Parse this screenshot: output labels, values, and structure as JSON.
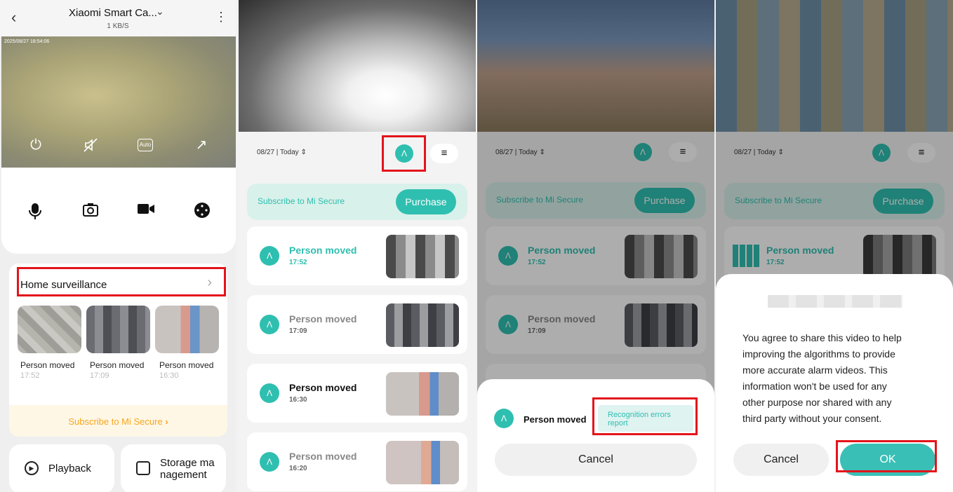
{
  "colors": {
    "accent": "#2fbfb0",
    "highlight_box": "#e3141b",
    "orange": "#f5a623"
  },
  "p1": {
    "title": "Xiaomi Smart Ca...",
    "speed": "1 KB/S",
    "timestamp": "2025/08/27 18:54:06",
    "auto_label": "Auto",
    "home_surveillance": "Home surveillance",
    "thumbs": [
      {
        "label": "Person moved",
        "time": "17:52"
      },
      {
        "label": "Person moved",
        "time": "17:09"
      },
      {
        "label": "Person moved",
        "time": "16:30"
      }
    ],
    "subscribe": "Subscribe to Mi Secure",
    "playback": "Playback",
    "storage_1": "Storage ma",
    "storage_2": "nagement"
  },
  "list": {
    "date": "08/27 | Today",
    "subscribe": "Subscribe to Mi Secure",
    "purchase": "Purchase",
    "events": [
      {
        "title": "Person moved",
        "time": "17:52"
      },
      {
        "title": "Person moved",
        "time": "17:09"
      },
      {
        "title": "Person moved",
        "time": "16:30"
      },
      {
        "title": "Person moved",
        "time": "16:20"
      }
    ]
  },
  "p3": {
    "sheet_title": "Person moved",
    "report_1": "Recognition errors",
    "report_2": "report",
    "cancel": "Cancel"
  },
  "p4": {
    "dialog_lines": [
      "You agree to share this video to help",
      "improving the algorithms to provide",
      "more accurate alarm videos. This",
      "information won't be used for any",
      "other purpose nor shared with any",
      "third party without your consent."
    ],
    "cancel": "Cancel",
    "ok": "OK"
  }
}
